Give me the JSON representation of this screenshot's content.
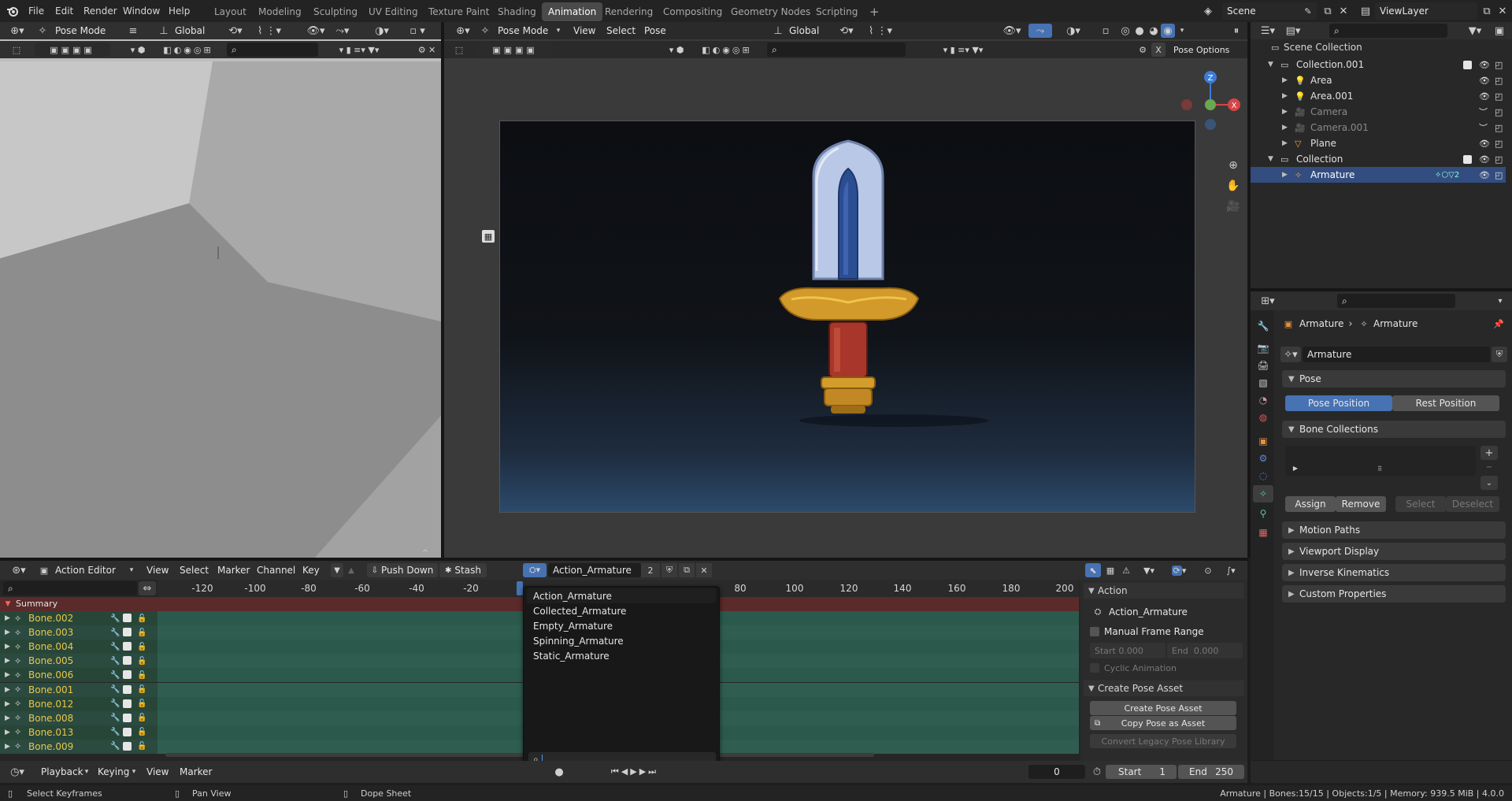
{
  "topbar": {
    "menus": [
      "File",
      "Edit",
      "Render",
      "Window",
      "Help"
    ],
    "tabs": [
      "Layout",
      "Modeling",
      "Sculpting",
      "UV Editing",
      "Texture Paint",
      "Shading",
      "Animation",
      "Rendering",
      "Compositing",
      "Geometry Nodes",
      "Scripting"
    ],
    "active_tab": "Animation",
    "add_tab": "+",
    "scene": "Scene",
    "view_layer": "ViewLayer"
  },
  "left_viewport": {
    "mode": "Pose Mode",
    "orientation": "Global"
  },
  "main_viewport": {
    "mode": "Pose Mode",
    "menus": [
      "View",
      "Select",
      "Pose"
    ],
    "orientation": "Global",
    "pose_options": "Pose Options",
    "x_label": "X",
    "gizmo": {
      "z": "Z",
      "x": "X"
    }
  },
  "outliner": {
    "title": "Scene Collection",
    "rows": [
      {
        "name": "Collection.001",
        "level": 1,
        "type": "collection"
      },
      {
        "name": "Area",
        "level": 2,
        "type": "light"
      },
      {
        "name": "Area.001",
        "level": 2,
        "type": "light"
      },
      {
        "name": "Camera",
        "level": 2,
        "type": "camera",
        "dim": true
      },
      {
        "name": "Camera.001",
        "level": 2,
        "type": "camera",
        "dim": true
      },
      {
        "name": "Plane",
        "level": 2,
        "type": "mesh"
      },
      {
        "name": "Collection",
        "level": 1,
        "type": "collection"
      },
      {
        "name": "Armature",
        "level": 2,
        "type": "armature",
        "selected": true
      }
    ],
    "armature_badge": "2"
  },
  "properties": {
    "breadcrumb": [
      "Armature",
      "Armature"
    ],
    "datablock": "Armature",
    "pose_panel": "Pose",
    "pose_position": "Pose Position",
    "rest_position": "Rest Position",
    "bone_collections": "Bone Collections",
    "assign": "Assign",
    "remove": "Remove",
    "select": "Select",
    "deselect": "Deselect",
    "panels": [
      "Motion Paths",
      "Viewport Display",
      "Inverse Kinematics",
      "Custom Properties"
    ]
  },
  "action_editor": {
    "editor": "Action Editor",
    "menus": [
      "View",
      "Select",
      "Marker",
      "Channel",
      "Key"
    ],
    "push_down": "Push Down",
    "stash": "Stash",
    "action_name": "Action_Armature",
    "user_count": "2",
    "ticks": [
      "-120",
      "-100",
      "-80",
      "-60",
      "-40",
      "-20",
      "80",
      "100",
      "120",
      "140",
      "160",
      "180",
      "200"
    ],
    "summary": "Summary",
    "bones": [
      "Bone.002",
      "Bone.003",
      "Bone.004",
      "Bone.005",
      "Bone.006",
      "Bone.001",
      "Bone.012",
      "Bone.008",
      "Bone.013",
      "Bone.009"
    ],
    "dropdown_items": [
      "Action_Armature",
      "Collected_Armature",
      "Empty_Armature",
      "Spinning_Armature",
      "Static_Armature"
    ],
    "side": {
      "action_panel": "Action",
      "action_name": "Action_Armature",
      "manual_range": "Manual Frame Range",
      "start_label": "Start",
      "start_value": "0.000",
      "end_label": "End",
      "end_value": "0.000",
      "cyclic": "Cyclic Animation",
      "create_pose_panel": "Create Pose Asset",
      "create_pose": "Create Pose Asset",
      "copy_pose": "Copy Pose as Asset",
      "convert_legacy": "Convert Legacy Pose Library"
    }
  },
  "timeline": {
    "playback": "Playback",
    "keying": "Keying",
    "view": "View",
    "marker": "Marker",
    "current_frame": "0",
    "start_label": "Start",
    "start": "1",
    "end_label": "End",
    "end": "250"
  },
  "status": {
    "left": "Select Keyframes",
    "mid": "Pan View",
    "right_hint": "Dope Sheet",
    "info": "Armature | Bones:15/15 | Objects:1/5 | Memory: 939.5 MiB | 4.0.0"
  },
  "colors": {
    "accent": "#4772b3",
    "bone_text": "#e8c64a",
    "channel_green": "#2b5a4c",
    "summary_red": "#5b2a2a"
  }
}
